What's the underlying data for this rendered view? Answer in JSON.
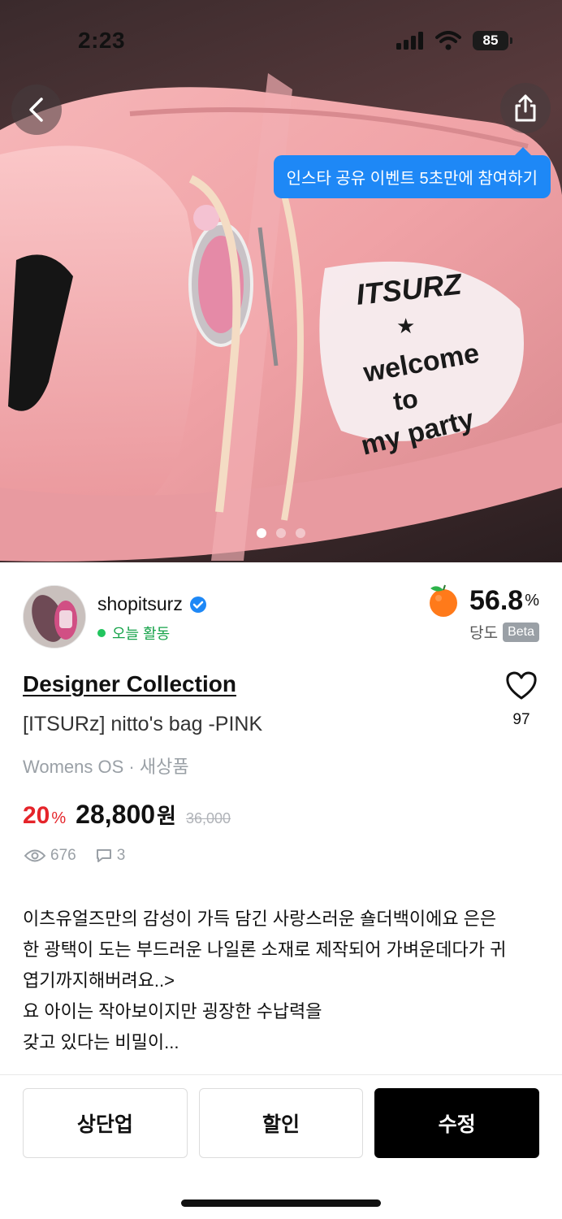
{
  "status_bar": {
    "time": "2:23",
    "battery": "85"
  },
  "hero": {
    "tooltip": "인스타 공유 이벤트 5초만에 참여하기",
    "photo_text": [
      "ITSURZ",
      "★",
      "welcome",
      "to",
      "my party"
    ],
    "carousel": {
      "count": 3,
      "active_index": 0
    },
    "back_icon": "chevron-left-icon",
    "share_icon": "share-icon"
  },
  "seller": {
    "name": "shopitsurz",
    "status": "오늘 활동",
    "score_value": "56.8",
    "score_unit": "%",
    "score_label": "당도",
    "beta": "Beta"
  },
  "product": {
    "brand": "Designer Collection",
    "title": "[ITSURz] nitto's bag -PINK",
    "meta": "Womens OS · 새상품",
    "likes": "97",
    "discount": "20",
    "discount_unit": "%",
    "price": "28,800",
    "price_unit": "원",
    "original_price": "36,000",
    "views": "676",
    "comments": "3",
    "description_lines": [
      "이츠유얼즈만의 감성이 가득 담긴 사랑스러운 숄더백이에요 은은",
      "한 광택이 도는 부드러운 나일론 소재로 제작되어 가벼운데다가 귀",
      "엽기까지해버려요..>",
      "요 아이는 작아보이지만 굉장한 수납력을",
      "갖고 있다는 비밀이..."
    ]
  },
  "actions": {
    "bump": "상단업",
    "discount": "할인",
    "edit": "수정"
  },
  "colors": {
    "accent_blue": "#1e88f6",
    "sale_red": "#e5242a",
    "online_green": "#22c55e",
    "primary_black": "#000000"
  }
}
